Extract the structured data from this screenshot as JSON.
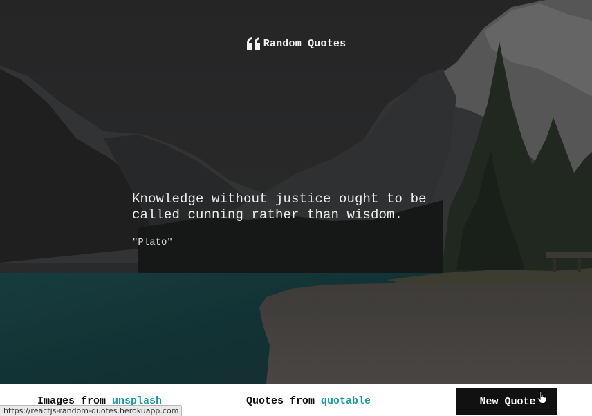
{
  "header": {
    "icon": "quote-left-icon",
    "title": "Random Quotes"
  },
  "quote": {
    "text": "Knowledge without justice ought to be called cunning rather than wisdom.",
    "author": "\"Plato\""
  },
  "footer": {
    "images_prefix": "Images from ",
    "images_link": "unsplash",
    "quotes_prefix": "Quotes from ",
    "quotes_link": "quotable",
    "new_quote_label": "New Quote"
  },
  "status_bar": {
    "url": "https://reactjs-random-quotes.herokuapp.com"
  },
  "colors": {
    "link": "#1b9aa8",
    "button_bg": "#111111",
    "overlay": "#2b2b2b"
  }
}
